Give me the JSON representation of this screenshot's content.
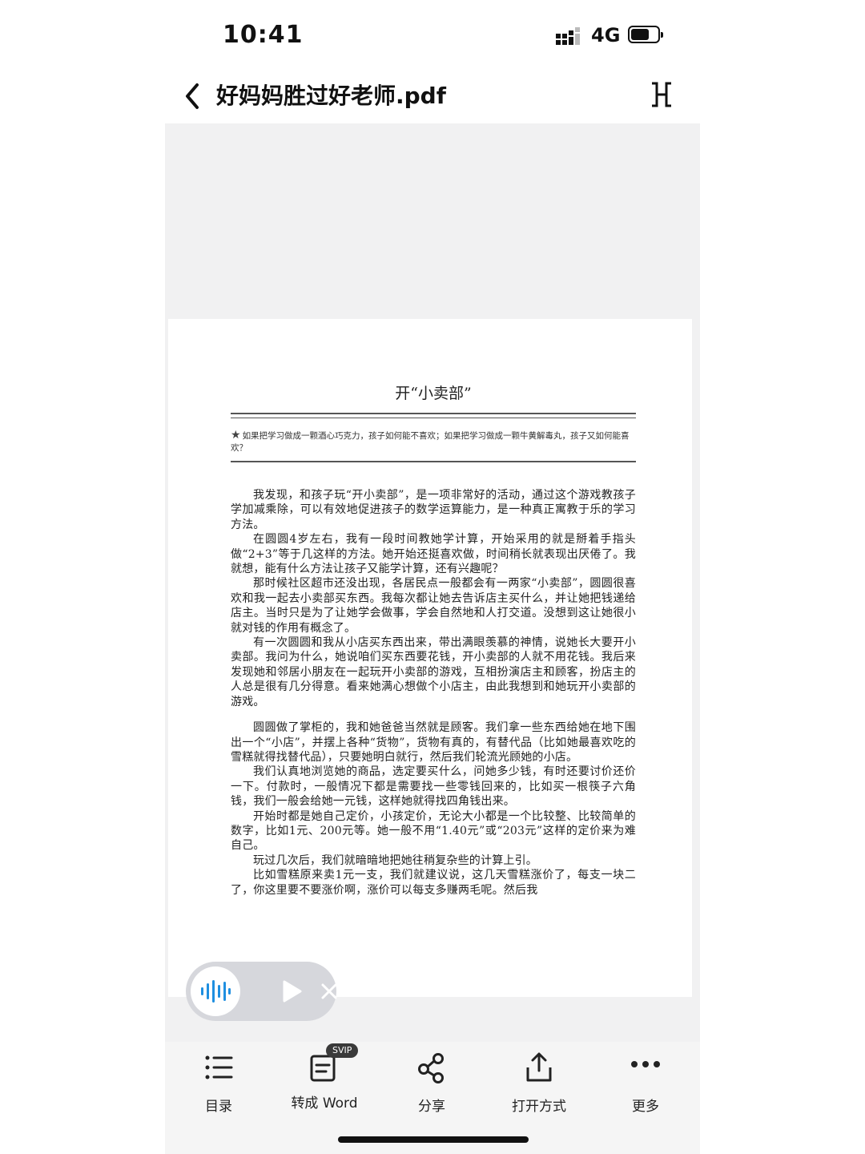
{
  "status_bar": {
    "time": "10:41",
    "network": "4G"
  },
  "nav": {
    "title": "好妈妈胜过好老师.pdf"
  },
  "document": {
    "chapter_title": "开“小卖部”",
    "epigraph": "如果把学习做成一颗酒心巧克力，孩子如何能不喜欢；如果把学习做成一颗牛黄解毒丸，孩子又如何能喜欢？",
    "paragraphs_1": [
      "我发现，和孩子玩“开小卖部”，是一项非常好的活动，通过这个游戏教孩子学加减乘除，可以有效地促进孩子的数学运算能力，是一种真正寓教于乐的学习方法。",
      "在圆圆4岁左右，我有一段时间教她学计算，开始采用的就是掰着手指头做“2+3”等于几这样的方法。她开始还挺喜欢做，时间稍长就表现出厌倦了。我就想，能有什么方法让孩子又能学计算，还有兴趣呢？",
      "那时候社区超市还没出现，各居民点一般都会有一两家“小卖部”，圆圆很喜欢和我一起去小卖部买东西。我每次都让她去告诉店主买什么，并让她把钱递给店主。当时只是为了让她学会做事，学会自然地和人打交道。没想到这让她很小就对钱的作用有概念了。",
      "有一次圆圆和我从小店买东西出来，带出满眼羡慕的神情，说她长大要开小卖部。我问为什么，她说咱们买东西要花钱，开小卖部的人就不用花钱。我后来发现她和邻居小朋友在一起玩开小卖部的游戏，互相扮演店主和顾客，扮店主的人总是很有几分得意。看来她满心想做个小店主，由此我想到和她玩开小卖部的游戏。"
    ],
    "paragraphs_2": [
      "圆圆做了掌柜的，我和她爸爸当然就是顾客。我们拿一些东西给她在地下围出一个“小店”，并摆上各种“货物”，货物有真的，有替代品（比如她最喜欢吃的雪糕就得找替代品），只要她明白就行，然后我们轮流光顾她的小店。",
      "我们认真地浏览她的商品，选定要买什么，问她多少钱，有时还要讨价还价一下。付款时，一般情况下都是需要找一些零钱回来的，比如买一根筷子六角钱，我们一般会给她一元钱，这样她就得找四角钱出来。",
      "开始时都是她自己定价，小孩定价，无论大小都是一个比较整、比较简单的数字，比如1元、200元等。她一般不用“1.40元”或“203元”这样的定价来为难自己。",
      "玩过几次后，我们就暗暗地把她往稍复杂些的计算上引。",
      "比如雪糕原来卖1元一支，我们就建议说，这几天雪糕涨价了，每支一块二了，你这里要不要涨价啊，涨价可以每支多赚两毛呢。然后我"
    ]
  },
  "toolbar": {
    "items": [
      {
        "label": "目录"
      },
      {
        "label": "转成 Word",
        "badge": "SVIP"
      },
      {
        "label": "分享"
      },
      {
        "label": "打开方式"
      },
      {
        "label": "更多"
      }
    ]
  },
  "colors": {
    "audio_accent": "#1f8fe0",
    "reader_bg": "#f1f1f2",
    "widget_bg": "#d6d7dc"
  }
}
